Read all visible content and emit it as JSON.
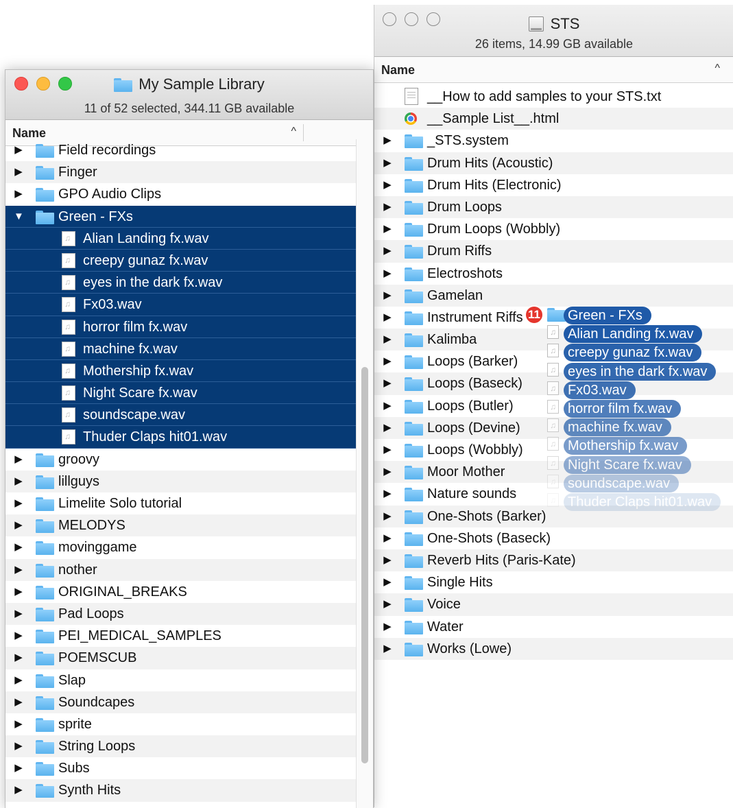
{
  "right_window": {
    "title": "STS",
    "status": "26 items, 14.99 GB available",
    "column_name": "Name",
    "sort_indicator": "^",
    "rows": [
      {
        "label": "__How to add samples to your STS.txt",
        "type": "txt"
      },
      {
        "label": "__Sample List__.html",
        "type": "html"
      },
      {
        "label": "_STS.system",
        "type": "folder"
      },
      {
        "label": "Drum Hits (Acoustic)",
        "type": "folder"
      },
      {
        "label": "Drum Hits (Electronic)",
        "type": "folder"
      },
      {
        "label": "Drum Loops",
        "type": "folder"
      },
      {
        "label": "Drum Loops (Wobbly)",
        "type": "folder"
      },
      {
        "label": "Drum Riffs",
        "type": "folder"
      },
      {
        "label": "Electroshots",
        "type": "folder"
      },
      {
        "label": "Gamelan",
        "type": "folder"
      },
      {
        "label": "Instrument Riffs",
        "type": "folder"
      },
      {
        "label": "Kalimba",
        "type": "folder"
      },
      {
        "label": "Loops (Barker)",
        "type": "folder"
      },
      {
        "label": "Loops (Baseck)",
        "type": "folder"
      },
      {
        "label": "Loops (Butler)",
        "type": "folder"
      },
      {
        "label": "Loops (Devine)",
        "type": "folder"
      },
      {
        "label": "Loops (Wobbly)",
        "type": "folder"
      },
      {
        "label": "Moor Mother",
        "type": "folder"
      },
      {
        "label": "Nature sounds",
        "type": "folder"
      },
      {
        "label": "One-Shots (Barker)",
        "type": "folder"
      },
      {
        "label": "One-Shots (Baseck)",
        "type": "folder"
      },
      {
        "label": "Reverb Hits (Paris-Kate)",
        "type": "folder"
      },
      {
        "label": "Single Hits",
        "type": "folder"
      },
      {
        "label": "Voice",
        "type": "folder"
      },
      {
        "label": "Water",
        "type": "folder"
      },
      {
        "label": "Works (Lowe)",
        "type": "folder"
      }
    ]
  },
  "left_window": {
    "title": "My Sample Library",
    "status": "11 of 52 selected, 344.11 GB available",
    "column_name": "Name",
    "sort_indicator": "^",
    "rows": [
      {
        "label": "Field recordings",
        "type": "folder",
        "expanded": false,
        "selected": false
      },
      {
        "label": "Finger",
        "type": "folder",
        "expanded": false,
        "selected": false
      },
      {
        "label": "GPO Audio Clips",
        "type": "folder",
        "expanded": false,
        "selected": false
      },
      {
        "label": "Green - FXs",
        "type": "folder",
        "expanded": true,
        "selected": true
      },
      {
        "label": "Alian Landing fx.wav",
        "type": "audio",
        "selected": true
      },
      {
        "label": "creepy gunaz fx.wav",
        "type": "audio",
        "selected": true
      },
      {
        "label": "eyes in the dark fx.wav",
        "type": "audio",
        "selected": true
      },
      {
        "label": "Fx03.wav",
        "type": "audio",
        "selected": true
      },
      {
        "label": "horror film fx.wav",
        "type": "audio",
        "selected": true
      },
      {
        "label": "machine fx.wav",
        "type": "audio",
        "selected": true
      },
      {
        "label": "Mothership fx.wav",
        "type": "audio",
        "selected": true
      },
      {
        "label": "Night Scare fx.wav",
        "type": "audio",
        "selected": true
      },
      {
        "label": "soundscape.wav",
        "type": "audio",
        "selected": true
      },
      {
        "label": "Thuder Claps hit01.wav",
        "type": "audio",
        "selected": true
      },
      {
        "label": "groovy",
        "type": "folder",
        "expanded": false,
        "selected": false
      },
      {
        "label": "lillguys",
        "type": "folder",
        "expanded": false,
        "selected": false
      },
      {
        "label": "Limelite Solo tutorial",
        "type": "folder",
        "expanded": false,
        "selected": false
      },
      {
        "label": "MELODYS",
        "type": "folder",
        "expanded": false,
        "selected": false
      },
      {
        "label": "movinggame",
        "type": "folder",
        "expanded": false,
        "selected": false
      },
      {
        "label": "nother",
        "type": "folder",
        "expanded": false,
        "selected": false
      },
      {
        "label": "ORIGINAL_BREAKS",
        "type": "folder",
        "expanded": false,
        "selected": false
      },
      {
        "label": "Pad Loops",
        "type": "folder",
        "expanded": false,
        "selected": false
      },
      {
        "label": "PEI_MEDICAL_SAMPLES",
        "type": "folder",
        "expanded": false,
        "selected": false
      },
      {
        "label": "POEMSCUB",
        "type": "folder",
        "expanded": false,
        "selected": false
      },
      {
        "label": "Slap",
        "type": "folder",
        "expanded": false,
        "selected": false
      },
      {
        "label": "Soundcapes",
        "type": "folder",
        "expanded": false,
        "selected": false
      },
      {
        "label": "sprite",
        "type": "folder",
        "expanded": false,
        "selected": false
      },
      {
        "label": "String Loops",
        "type": "folder",
        "expanded": false,
        "selected": false
      },
      {
        "label": "Subs",
        "type": "folder",
        "expanded": false,
        "selected": false
      },
      {
        "label": "Synth Hits",
        "type": "folder",
        "expanded": false,
        "selected": false
      }
    ]
  },
  "drag": {
    "count_badge": "11",
    "items": [
      {
        "label": "Green - FXs",
        "type": "folder",
        "opacity": 1.0
      },
      {
        "label": "Alian Landing fx.wav",
        "type": "audio",
        "opacity": 1.0
      },
      {
        "label": "creepy gunaz fx.wav",
        "type": "audio",
        "opacity": 0.95
      },
      {
        "label": "eyes in the dark fx.wav",
        "type": "audio",
        "opacity": 0.9
      },
      {
        "label": "Fx03.wav",
        "type": "audio",
        "opacity": 0.85
      },
      {
        "label": "horror film fx.wav",
        "type": "audio",
        "opacity": 0.78
      },
      {
        "label": "machine fx.wav",
        "type": "audio",
        "opacity": 0.7
      },
      {
        "label": "Mothership fx.wav",
        "type": "audio",
        "opacity": 0.6
      },
      {
        "label": "Night Scare fx.wav",
        "type": "audio",
        "opacity": 0.48
      },
      {
        "label": "soundscape.wav",
        "type": "audio",
        "opacity": 0.3
      },
      {
        "label": "Thuder Claps hit01.wav",
        "type": "audio",
        "opacity": 0.14
      }
    ]
  },
  "colors": {
    "selection": "#063a75",
    "folder": "#5ab3ee",
    "drag_pill": "#1f5aa8",
    "badge": "#e5362d"
  },
  "icons": {
    "disclosure_closed": "▶",
    "disclosure_open": "▼",
    "audio_note": "♫"
  }
}
